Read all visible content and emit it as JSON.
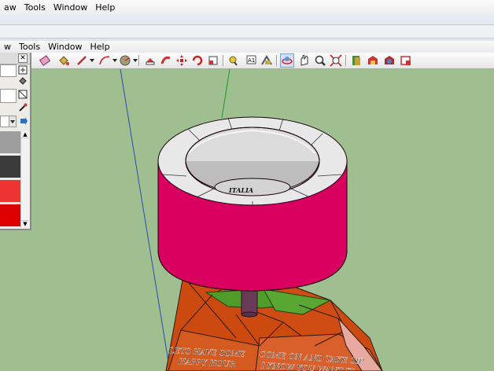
{
  "menubar_back": {
    "items": [
      "aw",
      "Tools",
      "Window",
      "Help"
    ]
  },
  "menubar_front": {
    "items": [
      "w",
      "Tools",
      "Window",
      "Help"
    ]
  },
  "model_text": {
    "bowl_label": "ITALIA",
    "sign_line1": "LETS HAVE  SOME",
    "sign_line2": "HAPPY HOUR",
    "sign_line3": "COME ON AND TAKE SIP,",
    "sign_line4": "I KNOW YOU WANT IT"
  },
  "colors": {
    "viewport_bg": "#9fbf90",
    "bowl_rim_outer": "#d9005f",
    "bowl_top": "#e8e8e8",
    "stem": "#6a3b57",
    "base_orange": "#cc4a10",
    "base_green": "#4f9c2a",
    "base_pink": "#e8aaa0",
    "axis_blue": "#2c4bb0",
    "axis_green": "#1d9b1d"
  },
  "materials_swatches": [
    "#9e9e9e",
    "#3b3b3b",
    "#ee3333",
    "#dd0000"
  ]
}
